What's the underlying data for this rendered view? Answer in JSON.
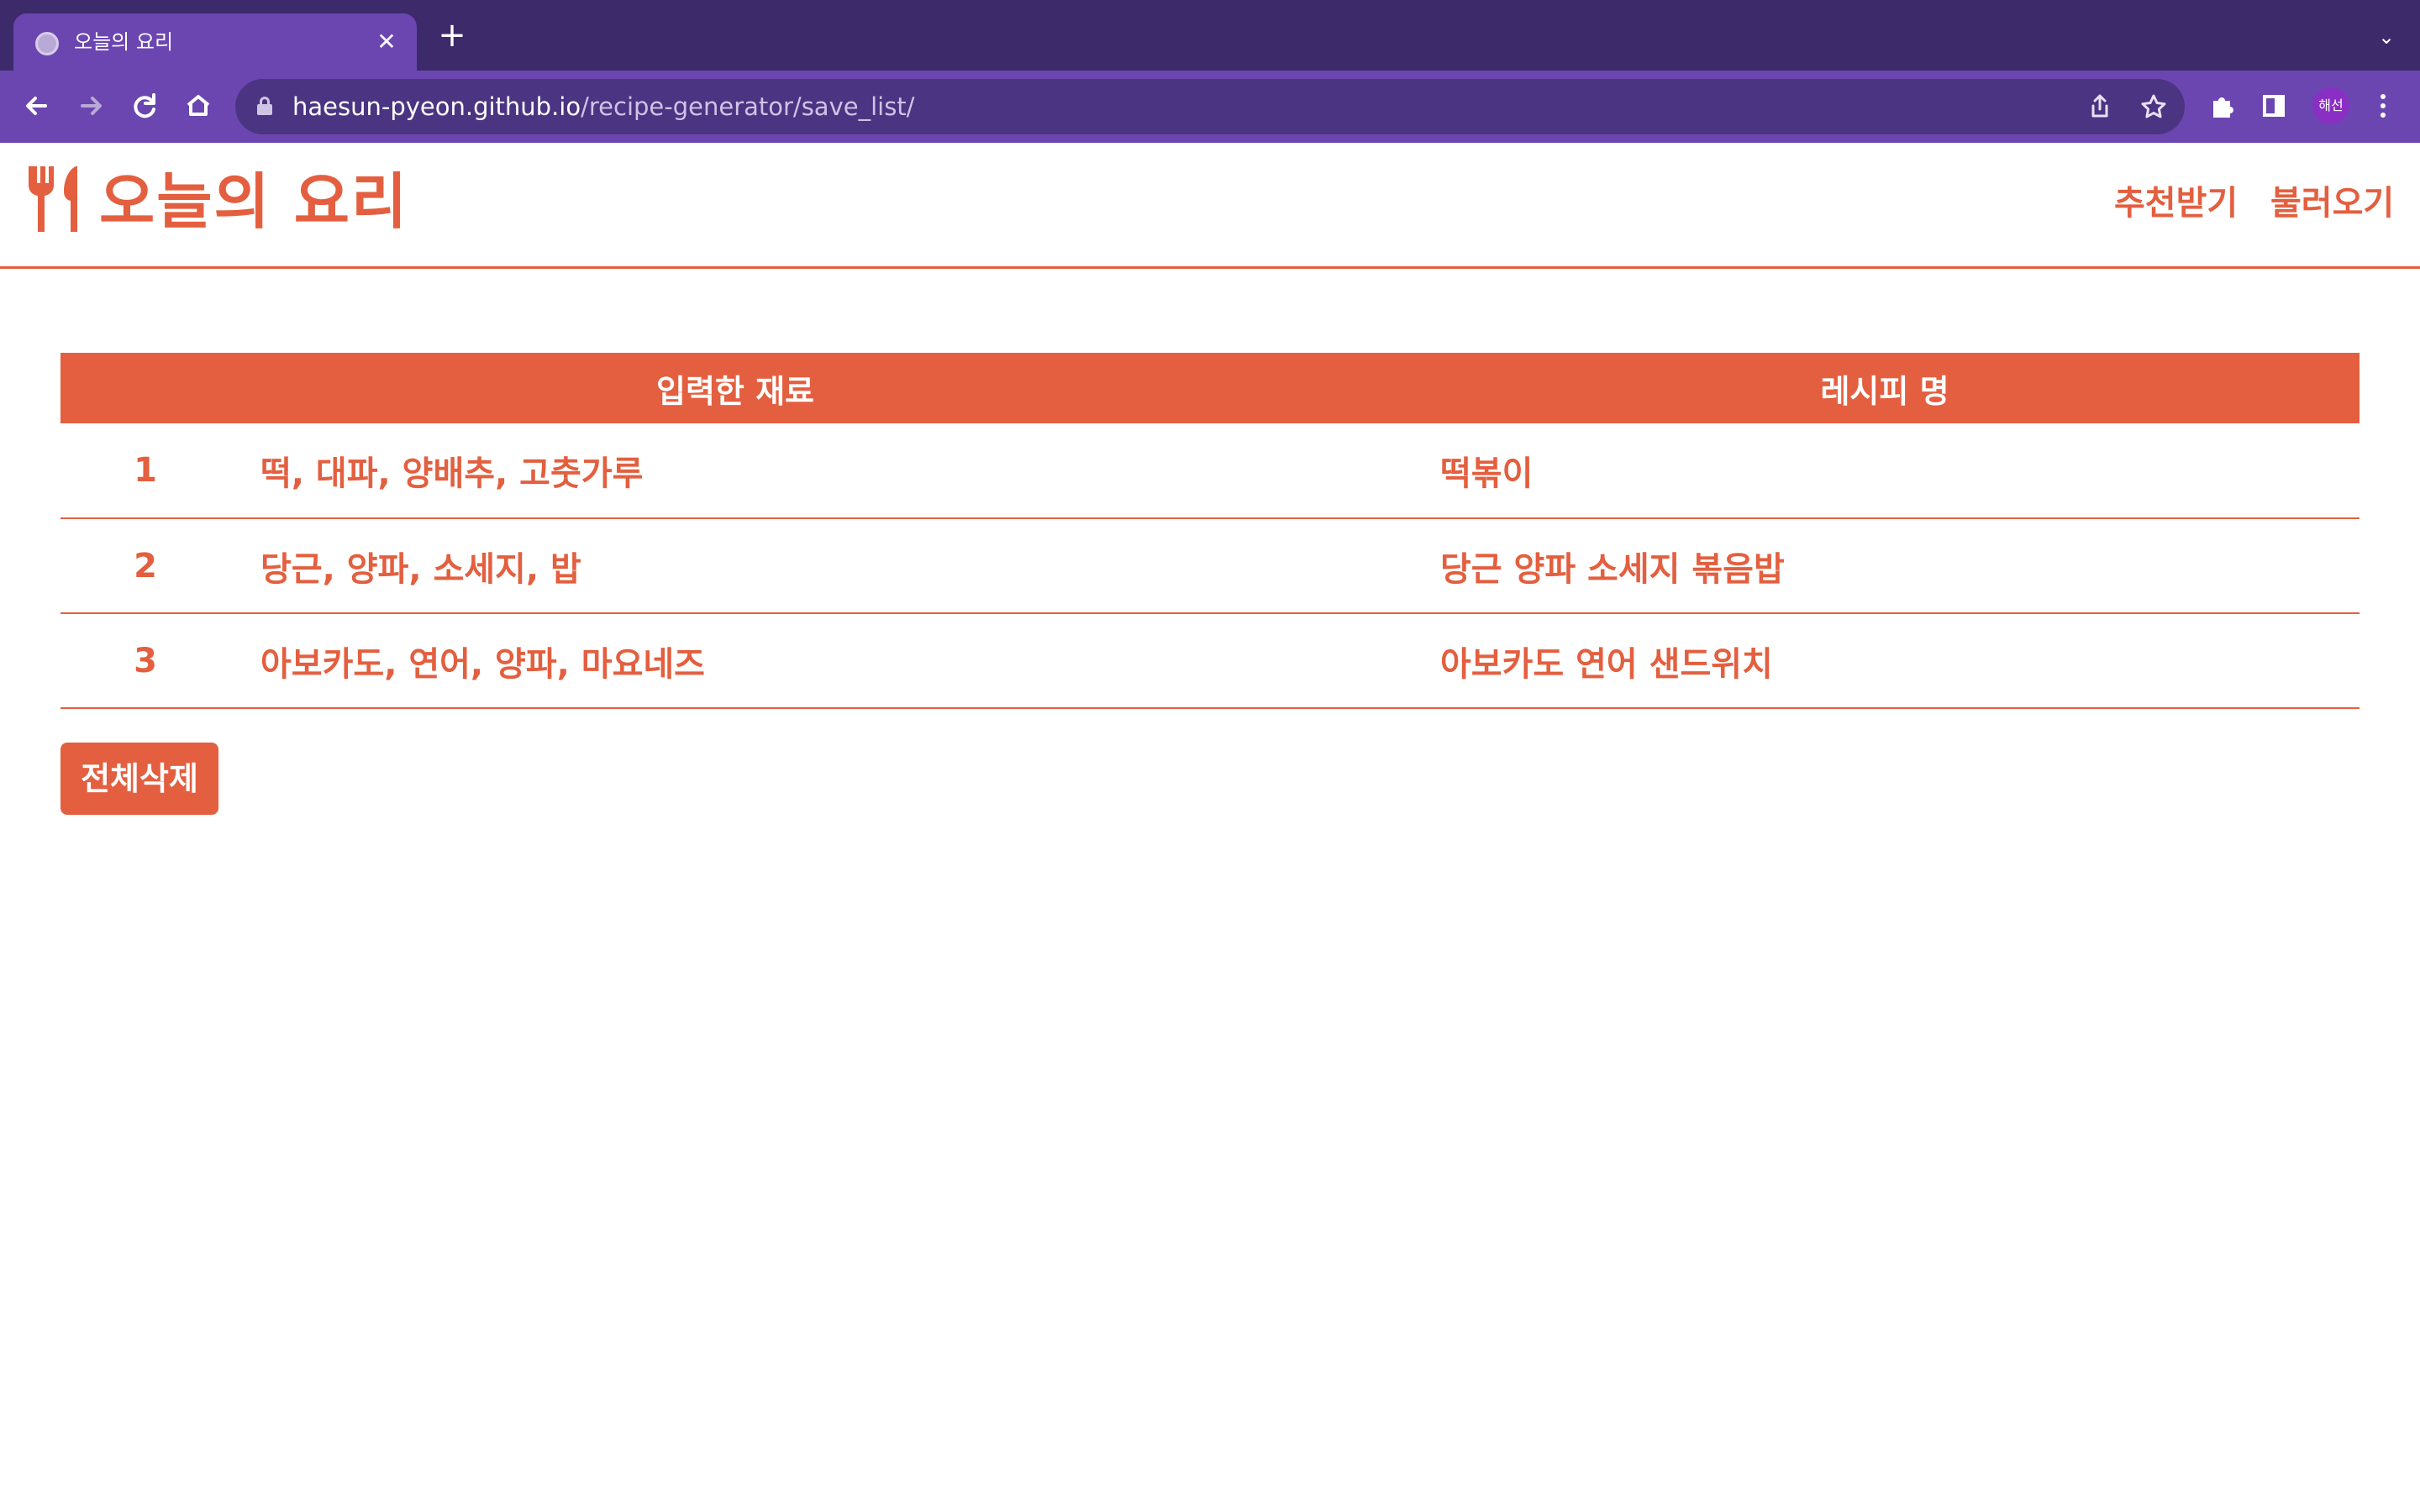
{
  "browser": {
    "tab_title": "오늘의 요리",
    "tab_close": "✕",
    "new_tab": "+",
    "tab_menu": "⌄",
    "url_host": "haesun-pyeon.github.io",
    "url_path": "/recipe-generator/save_list/",
    "profile_label": "해선",
    "icons": [
      "back-arrow-icon",
      "forward-arrow-icon",
      "reload-icon",
      "home-icon",
      "lock-icon",
      "share-icon",
      "star-icon",
      "extensions-icon",
      "side-panel-icon",
      "kebab-menu-icon"
    ]
  },
  "header": {
    "logo": "오늘의 요리",
    "nav": [
      {
        "label": "추천받기"
      },
      {
        "label": "불러오기"
      }
    ]
  },
  "table": {
    "headers": [
      "입력한 재료",
      "레시피 명"
    ],
    "rows": [
      {
        "num": "1",
        "ingredients": "떡, 대파, 양배추, 고춧가루",
        "recipe": "떡볶이"
      },
      {
        "num": "2",
        "ingredients": "당근, 양파, 소세지, 밥",
        "recipe": "당근 양파 소세지 볶음밥"
      },
      {
        "num": "3",
        "ingredients": "아보카도, 연어, 양파, 마요네즈",
        "recipe": "아보카도 연어 샌드위치"
      }
    ]
  },
  "delete_all_label": "전체삭제",
  "colors": {
    "accent": "#e35f3f",
    "browser_frame": "#6b46b0",
    "browser_tabstrip": "#3d2a6b"
  }
}
